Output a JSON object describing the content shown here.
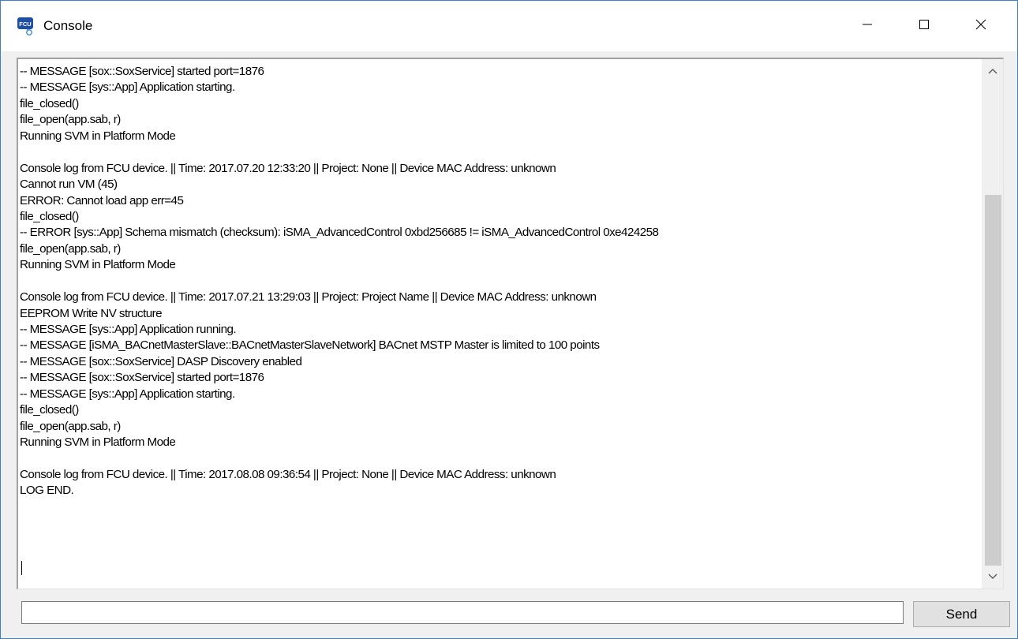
{
  "window": {
    "title": "Console",
    "icon_text": "FCU",
    "controls": {
      "minimize": "minimize-icon",
      "maximize": "maximize-icon",
      "close": "close-icon"
    }
  },
  "console": {
    "lines": [
      "-- MESSAGE [sox::SoxService] started port=1876",
      "-- MESSAGE [sys::App] Application starting.",
      "file_closed()",
      "file_open(app.sab, r)",
      "Running SVM in Platform Mode",
      "",
      "Console log from FCU device. || Time: 2017.07.20 12:33:20 || Project: None || Device MAC Address: unknown",
      "Cannot run VM (45)",
      "ERROR: Cannot load app err=45",
      "file_closed()",
      "-- ERROR [sys::App] Schema mismatch (checksum): iSMA_AdvancedControl 0xbd256685 != iSMA_AdvancedControl 0xe424258",
      "file_open(app.sab, r)",
      "Running SVM in Platform Mode",
      "",
      "Console log from FCU device. || Time: 2017.07.21 13:29:03 || Project: Project Name || Device MAC Address: unknown",
      "EEPROM Write NV structure",
      "-- MESSAGE [sys::App] Application running.",
      "-- MESSAGE [iSMA_BACnetMasterSlave::BACnetMasterSlaveNetwork] BACnet MSTP Master is limited to 100 points",
      "-- MESSAGE [sox::SoxService] DASP Discovery enabled",
      "-- MESSAGE [sox::SoxService] started port=1876",
      "-- MESSAGE [sys::App] Application starting.",
      "file_closed()",
      "file_open(app.sab, r)",
      "Running SVM in Platform Mode",
      "",
      "Console log from FCU device. || Time: 2017.08.08 09:36:54 || Project: None || Device MAC Address: unknown",
      "LOG END."
    ]
  },
  "input": {
    "value": "",
    "placeholder": ""
  },
  "send_button": {
    "label": "Send"
  },
  "colors": {
    "window_border": "#3b7fd1",
    "background": "#f0f0f0",
    "icon_blue": "#1f4ea3"
  }
}
